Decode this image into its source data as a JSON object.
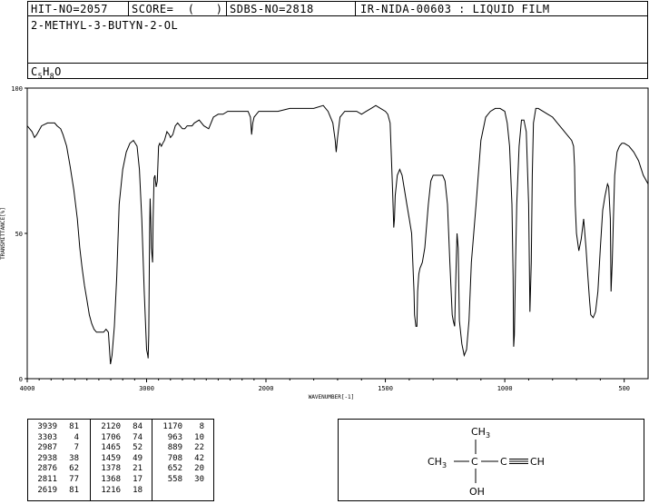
{
  "header": {
    "hit_no": "HIT-NO=2057",
    "score": "SCORE=  (   )",
    "sdbs_no": "SDBS-NO=2818",
    "ir_id": "IR-NIDA-00603 : LIQUID FILM",
    "compound_name": "2-METHYL-3-BUTYN-2-OL",
    "formula_main": "C",
    "formula_c_count": "5",
    "formula_h": "H",
    "formula_h_count": "8",
    "formula_o": "O"
  },
  "chart_data": {
    "type": "line",
    "xlabel": "WAVENUMBER[-1]",
    "ylabel": "TRANSMITTANCE[%]",
    "xlim": [
      4000,
      400
    ],
    "ylim": [
      0,
      100
    ],
    "x_ticks": [
      "4000",
      "3000",
      "2000",
      "1500",
      "1000",
      "500"
    ],
    "y_ticks": [
      "100",
      "50",
      "0"
    ],
    "series": [
      {
        "x": [
          4000,
          3960,
          3939,
          3920,
          3880,
          3830,
          3790,
          3770,
          3750,
          3720,
          3700,
          3670,
          3640,
          3610,
          3580,
          3560,
          3540,
          3520,
          3500,
          3480,
          3460,
          3440,
          3420,
          3400,
          3380,
          3360,
          3340,
          3320,
          3303,
          3290,
          3270,
          3250,
          3230,
          3200,
          3170,
          3140,
          3110,
          3080,
          3060,
          3040,
          3020,
          3000,
          2990,
          2987,
          2982,
          2975,
          2970,
          2965,
          2960,
          2950,
          2945,
          2938,
          2930,
          2920,
          2910,
          2900,
          2890,
          2876,
          2865,
          2850,
          2830,
          2811,
          2800,
          2780,
          2760,
          2740,
          2720,
          2700,
          2680,
          2660,
          2640,
          2619,
          2600,
          2560,
          2520,
          2480,
          2440,
          2400,
          2360,
          2320,
          2280,
          2240,
          2200,
          2170,
          2150,
          2130,
          2120,
          2110,
          2100,
          2060,
          2000,
          1950,
          1900,
          1850,
          1800,
          1760,
          1740,
          1720,
          1710,
          1706,
          1700,
          1690,
          1670,
          1650,
          1620,
          1600,
          1580,
          1560,
          1540,
          1520,
          1500,
          1490,
          1480,
          1470,
          1465,
          1462,
          1459,
          1455,
          1450,
          1440,
          1430,
          1420,
          1410,
          1400,
          1390,
          1385,
          1380,
          1378,
          1372,
          1368,
          1365,
          1360,
          1355,
          1345,
          1335,
          1320,
          1310,
          1300,
          1280,
          1260,
          1250,
          1240,
          1230,
          1220,
          1216,
          1210,
          1205,
          1200,
          1195,
          1190,
          1180,
          1175,
          1170,
          1165,
          1160,
          1150,
          1140,
          1120,
          1100,
          1080,
          1060,
          1040,
          1020,
          1000,
          990,
          980,
          970,
          965,
          963,
          960,
          955,
          950,
          940,
          930,
          920,
          910,
          900,
          895,
          889,
          885,
          880,
          870,
          860,
          840,
          820,
          800,
          780,
          760,
          740,
          720,
          712,
          708,
          705,
          700,
          690,
          680,
          670,
          660,
          652,
          645,
          640,
          630,
          620,
          610,
          600,
          590,
          580,
          570,
          565,
          558,
          555,
          550,
          545,
          540,
          530,
          520,
          510,
          500,
          480,
          460,
          440,
          420,
          400
        ],
        "y": [
          87,
          85,
          83,
          84,
          87,
          88,
          88,
          88,
          87,
          86,
          84,
          80,
          73,
          65,
          55,
          45,
          38,
          32,
          27,
          22,
          19,
          17,
          16,
          16,
          16,
          16,
          17,
          16,
          5,
          8,
          18,
          35,
          60,
          72,
          78,
          81,
          82,
          80,
          72,
          55,
          30,
          10,
          8,
          7,
          15,
          50,
          62,
          55,
          45,
          40,
          55,
          69,
          70,
          66,
          68,
          80,
          81,
          80,
          81,
          82,
          85,
          84,
          83,
          84,
          87,
          88,
          87,
          86,
          86,
          87,
          87,
          87,
          88,
          89,
          87,
          86,
          90,
          91,
          91,
          92,
          92,
          92,
          92,
          92,
          92,
          90,
          84,
          88,
          90,
          92,
          92,
          92,
          93,
          93,
          93,
          94,
          92,
          88,
          82,
          78,
          83,
          90,
          92,
          92,
          92,
          91,
          92,
          93,
          94,
          93,
          92,
          91,
          88,
          65,
          52,
          55,
          63,
          66,
          70,
          72,
          70,
          65,
          60,
          55,
          50,
          40,
          30,
          22,
          18,
          18,
          30,
          36,
          38,
          40,
          45,
          60,
          68,
          70,
          70,
          70,
          68,
          60,
          40,
          22,
          20,
          18,
          35,
          50,
          45,
          20,
          12,
          10,
          8,
          9,
          10,
          20,
          40,
          60,
          82,
          90,
          92,
          93,
          93,
          92,
          88,
          80,
          60,
          35,
          11,
          15,
          40,
          60,
          80,
          89,
          89,
          85,
          60,
          23,
          40,
          70,
          88,
          93,
          93,
          92,
          91,
          90,
          88,
          86,
          84,
          82,
          80,
          73,
          60,
          50,
          44,
          48,
          55,
          45,
          35,
          27,
          22,
          21,
          23,
          30,
          45,
          58,
          63,
          67,
          66,
          55,
          30,
          40,
          55,
          70,
          78,
          80,
          81,
          81,
          80,
          78,
          75,
          70,
          67
        ]
      }
    ]
  },
  "peaks": [
    {
      "wavenumber": "3939",
      "t": "81"
    },
    {
      "wavenumber": "3303",
      "t": "4"
    },
    {
      "wavenumber": "2987",
      "t": "7"
    },
    {
      "wavenumber": "2938",
      "t": "38"
    },
    {
      "wavenumber": "2876",
      "t": "62"
    },
    {
      "wavenumber": "2811",
      "t": "77"
    },
    {
      "wavenumber": "2619",
      "t": "81"
    },
    {
      "wavenumber": "2120",
      "t": "84"
    },
    {
      "wavenumber": "1706",
      "t": "74"
    },
    {
      "wavenumber": "1465",
      "t": "52"
    },
    {
      "wavenumber": "1459",
      "t": "49"
    },
    {
      "wavenumber": "1378",
      "t": "21"
    },
    {
      "wavenumber": "1368",
      "t": "17"
    },
    {
      "wavenumber": "1216",
      "t": "18"
    },
    {
      "wavenumber": "1170",
      "t": "8"
    },
    {
      "wavenumber": "963",
      "t": "10"
    },
    {
      "wavenumber": "889",
      "t": "22"
    },
    {
      "wavenumber": "708",
      "t": "42"
    },
    {
      "wavenumber": "652",
      "t": "20"
    },
    {
      "wavenumber": "558",
      "t": "30"
    }
  ],
  "structure": {
    "top_methyl": "CH",
    "top_methyl_sub": "3",
    "left_methyl": "CH",
    "left_methyl_sub": "3",
    "center_c": "C",
    "alkyne_c": "C",
    "terminal": "CH",
    "hydroxyl": "OH"
  }
}
